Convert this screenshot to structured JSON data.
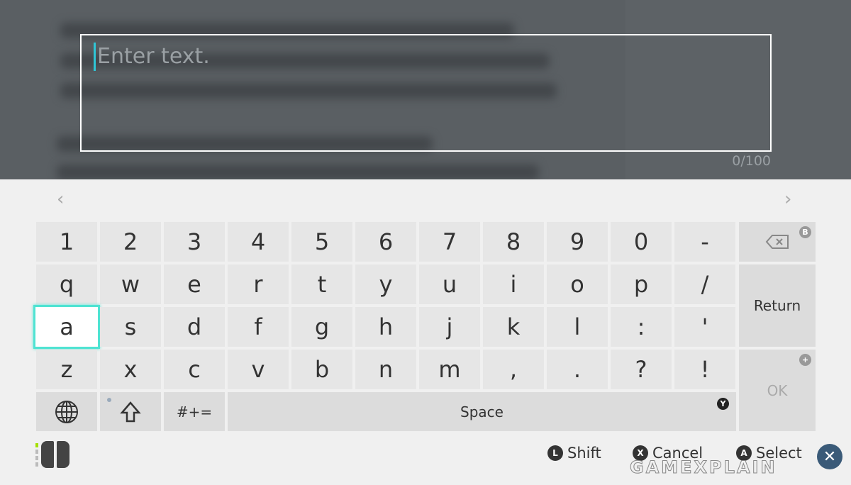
{
  "input": {
    "placeholder": "Enter text.",
    "counter": "0/100"
  },
  "nav": {
    "prev": "‹",
    "next": "›"
  },
  "rows": [
    [
      "1",
      "2",
      "3",
      "4",
      "5",
      "6",
      "7",
      "8",
      "9",
      "0",
      "-"
    ],
    [
      "q",
      "w",
      "e",
      "r",
      "t",
      "y",
      "u",
      "i",
      "o",
      "p",
      "/"
    ],
    [
      "a",
      "s",
      "d",
      "f",
      "g",
      "h",
      "j",
      "k",
      "l",
      ":",
      "'"
    ],
    [
      "z",
      "x",
      "c",
      "v",
      "b",
      "n",
      "m",
      ",",
      ".",
      "?",
      "!"
    ]
  ],
  "selected_key": "a",
  "bottom": {
    "symbols": "#+=",
    "space": "Space",
    "space_badge": "Y"
  },
  "side": {
    "backspace_badge": "B",
    "return": "Return",
    "ok": "OK",
    "ok_badge": "+"
  },
  "footer": {
    "shift_btn": "L",
    "shift": "Shift",
    "cancel_btn": "X",
    "cancel": "Cancel",
    "select_btn": "A",
    "select": "Select",
    "watermark": "GAMEXPLAIN"
  },
  "colors": {
    "accent": "#4fe3d2",
    "caret": "#2fc6d6",
    "controller_led": "#a4e000"
  }
}
